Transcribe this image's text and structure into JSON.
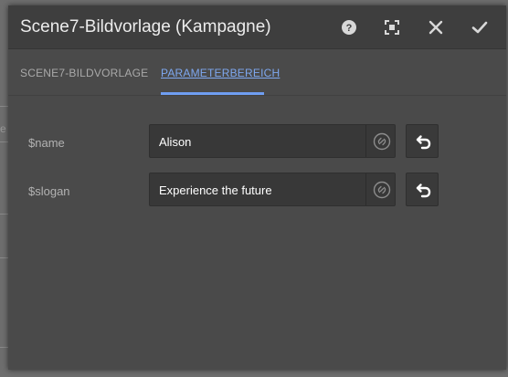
{
  "dialog": {
    "title": "Scene7-Bildvorlage (Kampagne)",
    "header_buttons": [
      "help-icon",
      "fullscreen-icon",
      "close-icon",
      "checkmark-icon"
    ]
  },
  "tabs": [
    {
      "label": "SCENE7-BILDVORLAGE",
      "active": false
    },
    {
      "label": "PARAMETERBEREICH",
      "active": true
    }
  ],
  "params": [
    {
      "label": "$name",
      "value": "Alison",
      "link_icon": "link-icon",
      "reset_icon": "undo-icon"
    },
    {
      "label": "$slogan",
      "value": "Experience the future",
      "link_icon": "link-icon",
      "reset_icon": "undo-icon"
    }
  ],
  "backdrop": {
    "partial_text": "e"
  },
  "colors": {
    "accent": "#6f9ef2",
    "dialog_bg": "#4a4a4a",
    "header_bg": "#3e3e3e"
  }
}
